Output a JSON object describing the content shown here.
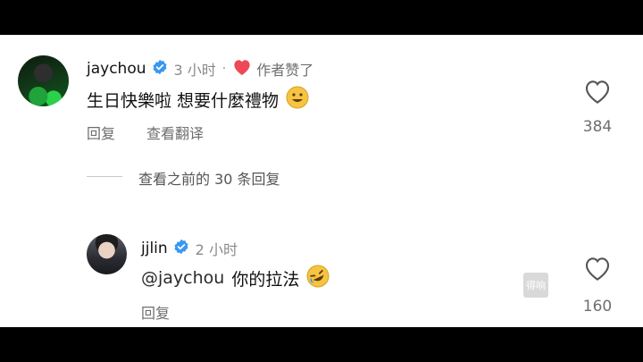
{
  "comments": [
    {
      "username": "jaychou",
      "time": "3 小时",
      "separator": "·",
      "author_liked": "作者赞了",
      "text": "生日快樂啦 想要什麼禮物",
      "reply": "回复",
      "translate": "查看翻译",
      "likes": "384"
    }
  ],
  "view_previous": "查看之前的 30 条回复",
  "replies": [
    {
      "username": "jjlin",
      "time": "2 小时",
      "mention": "@jaychou",
      "text": "你的拉法",
      "reply": "回复",
      "likes": "160"
    }
  ],
  "watermark": "得响",
  "colors": {
    "verified": "#3897f0",
    "heart": "#ed4956",
    "emoji": "#f6c343"
  },
  "icons": {
    "verified": "verified-badge-icon",
    "heart": "heart-icon",
    "like": "like-heart-outline-icon"
  }
}
